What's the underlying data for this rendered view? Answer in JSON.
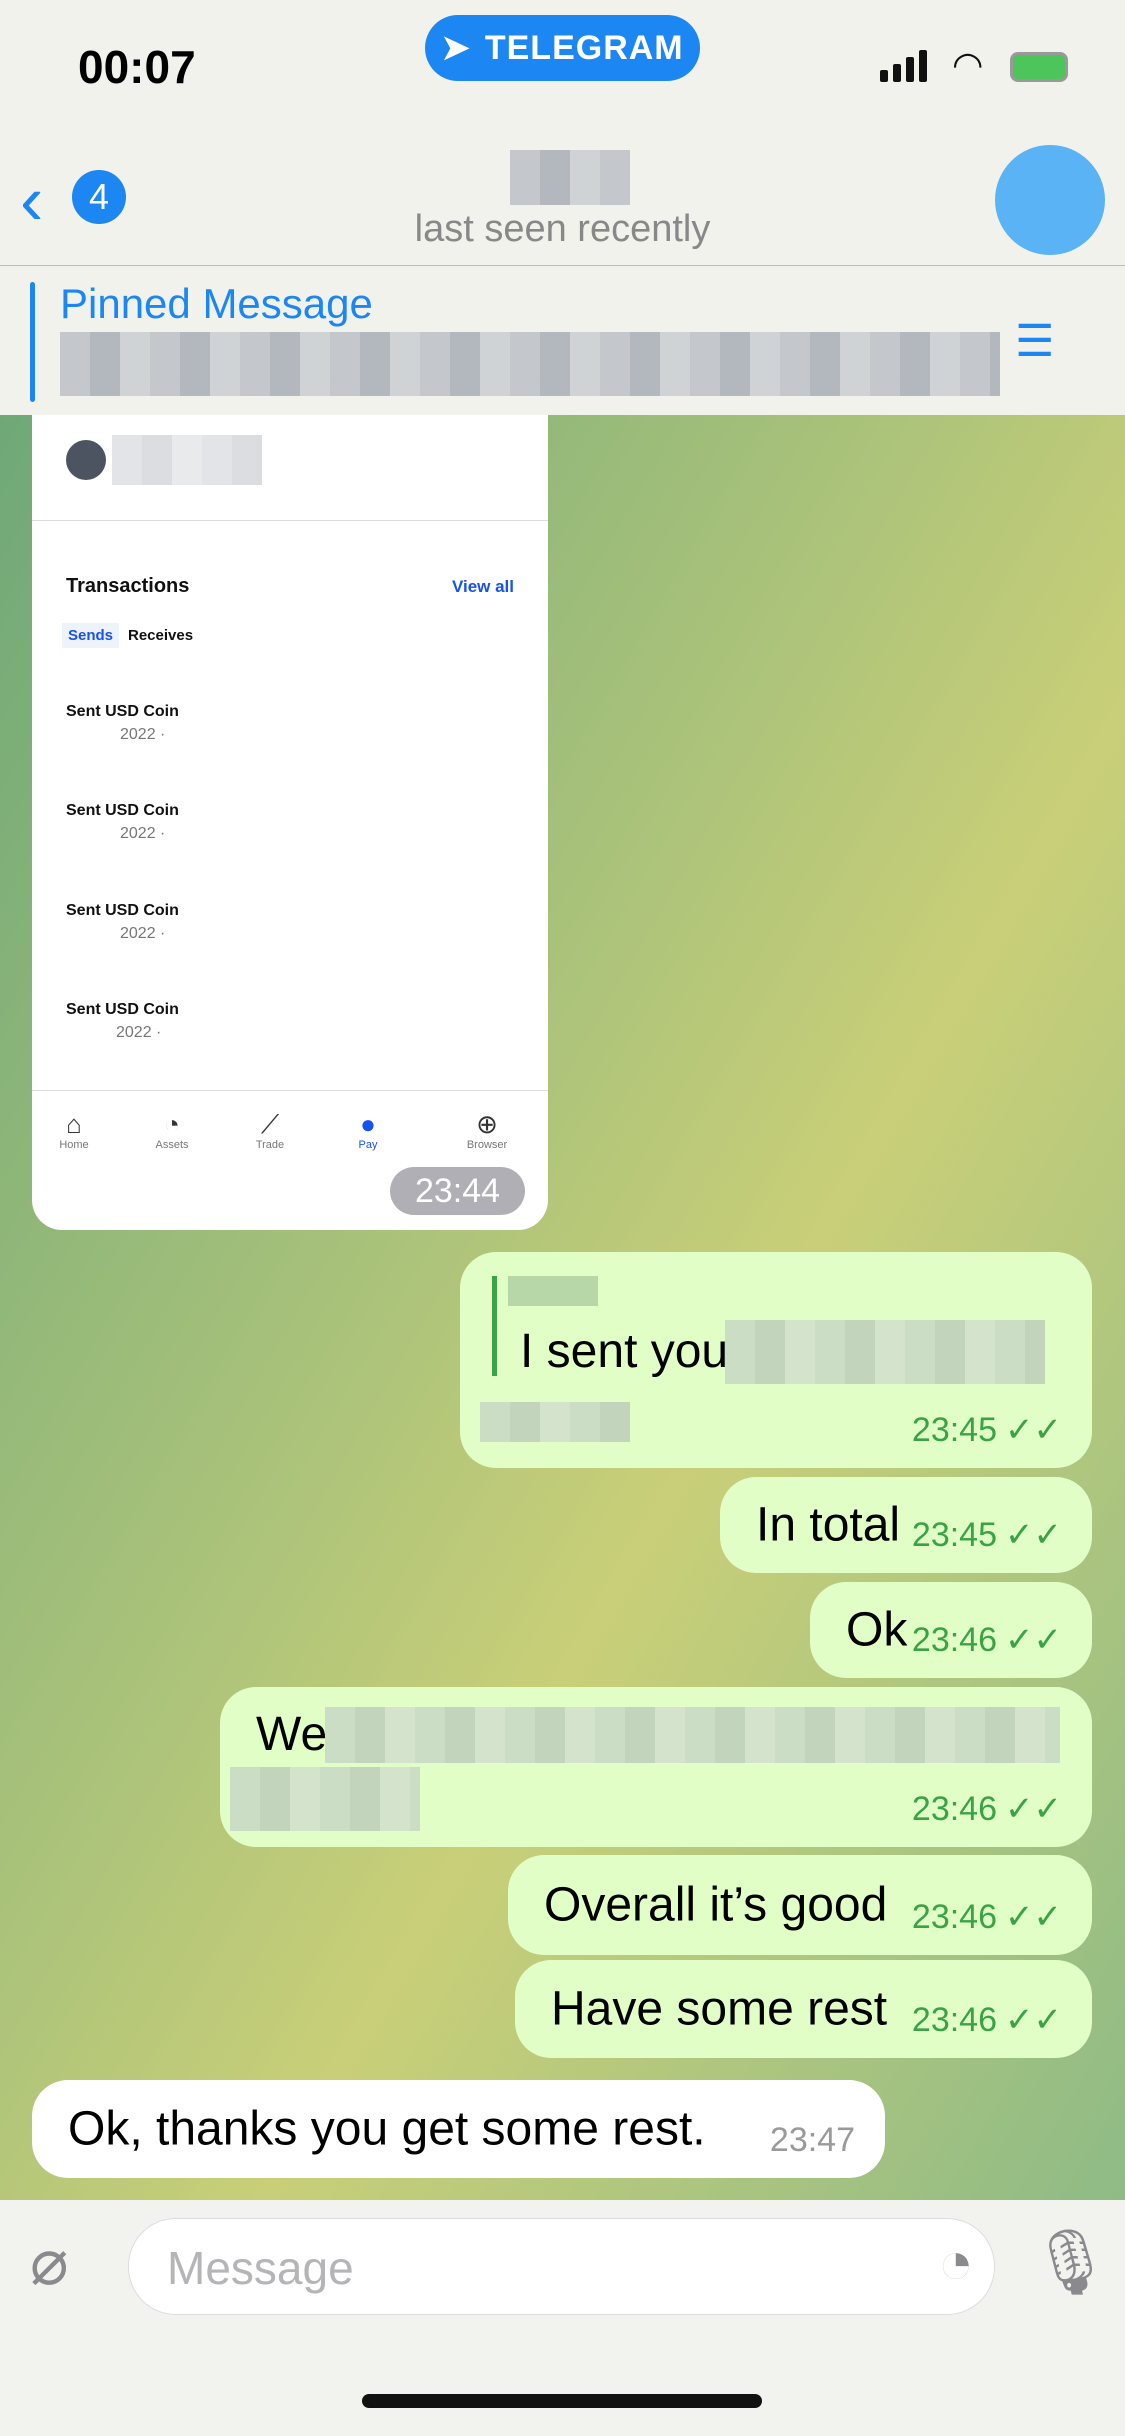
{
  "status": {
    "time": "00:07",
    "app_pill": "TELEGRAM"
  },
  "header": {
    "back_count": "4",
    "subtitle": "last seen recently"
  },
  "pinned": {
    "title": "Pinned Message"
  },
  "image_message": {
    "transactions_title": "Transactions",
    "view_all": "View all",
    "tabs": [
      "Sends",
      "Receives"
    ],
    "rows": [
      {
        "title": "Sent USD Coin",
        "year": "2022 ·"
      },
      {
        "title": "Sent USD Coin",
        "year": "2022 ·"
      },
      {
        "title": "Sent USD Coin",
        "year": "2022 ·"
      },
      {
        "title": "Sent USD Coin",
        "year": "2022 ·"
      }
    ],
    "nav": [
      "Home",
      "Assets",
      "Trade",
      "Pay",
      "Browser"
    ],
    "time": "23:44"
  },
  "messages": [
    {
      "text": "I sent you",
      "time": "23:45"
    },
    {
      "text": "In total",
      "time": "23:45"
    },
    {
      "text": "Ok",
      "time": "23:46"
    },
    {
      "text": "We",
      "time": "23:46"
    },
    {
      "text": "Overall it’s good",
      "time": "23:46"
    },
    {
      "text": "Have some rest",
      "time": "23:46"
    },
    {
      "text": "Ok, thanks you get some rest.",
      "time": "23:47"
    }
  ],
  "input": {
    "placeholder": "Message"
  },
  "colors": {
    "accent": "#1c86f2",
    "outgoing": "#e1fec6",
    "check": "#3aa346"
  }
}
